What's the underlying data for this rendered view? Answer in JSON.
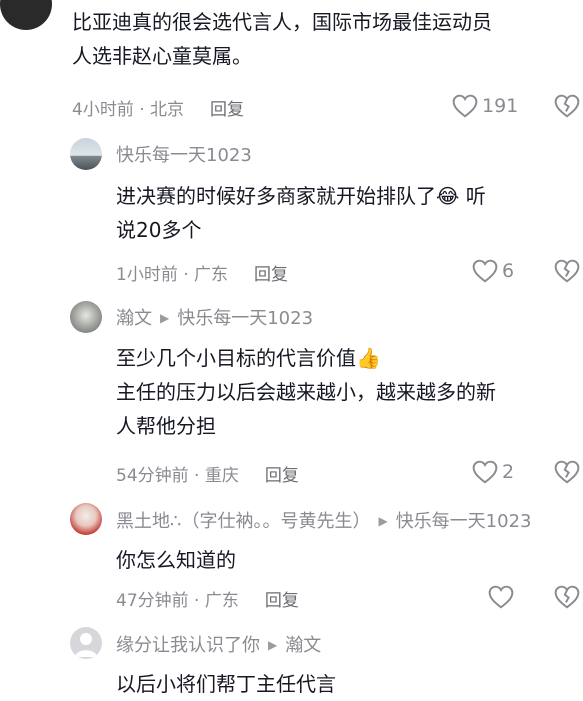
{
  "comments": [
    {
      "content_lines": [
        "比亚迪真的很会选代言人，国际市场最佳运动员",
        "人选非赵心童莫属。"
      ],
      "time": "4小时前",
      "location": "北京",
      "reply_label": "回复",
      "likes": "191"
    },
    {
      "username": "快乐每一天1023",
      "content_lines": [
        "进决赛的时候好多商家就开始排队了",
        "说20多个"
      ],
      "inline_text_after_emoji": " 听",
      "emoji": "😂",
      "time": "1小时前",
      "location": "广东",
      "reply_label": "回复",
      "likes": "6"
    },
    {
      "username": "瀚文",
      "reply_to": "快乐每一天1023",
      "content_lines": [
        "至少几个小目标的代言价值",
        "主任的压力以后会越来越小，越来越多的新",
        "人帮他分担"
      ],
      "emoji": "👍",
      "time": "54分钟前",
      "location": "重庆",
      "reply_label": "回复",
      "likes": "2"
    },
    {
      "username": "黑土地∴（字仕衲。。号黄先生）",
      "reply_to": "快乐每一天1023",
      "content_lines": [
        "你怎么知道的"
      ],
      "time": "47分钟前",
      "location": "广东",
      "reply_label": "回复"
    },
    {
      "username": "缘分让我认识了你",
      "reply_to": "瀚文",
      "content_lines": [
        "以后小将们帮丁主任代言"
      ]
    }
  ],
  "icons": {
    "like": "heart-outline-icon",
    "dislike": "broken-heart-icon",
    "reply_arrow": "triangle-right-icon"
  },
  "colors": {
    "text": "#161823",
    "secondary": "#8a8b91"
  }
}
